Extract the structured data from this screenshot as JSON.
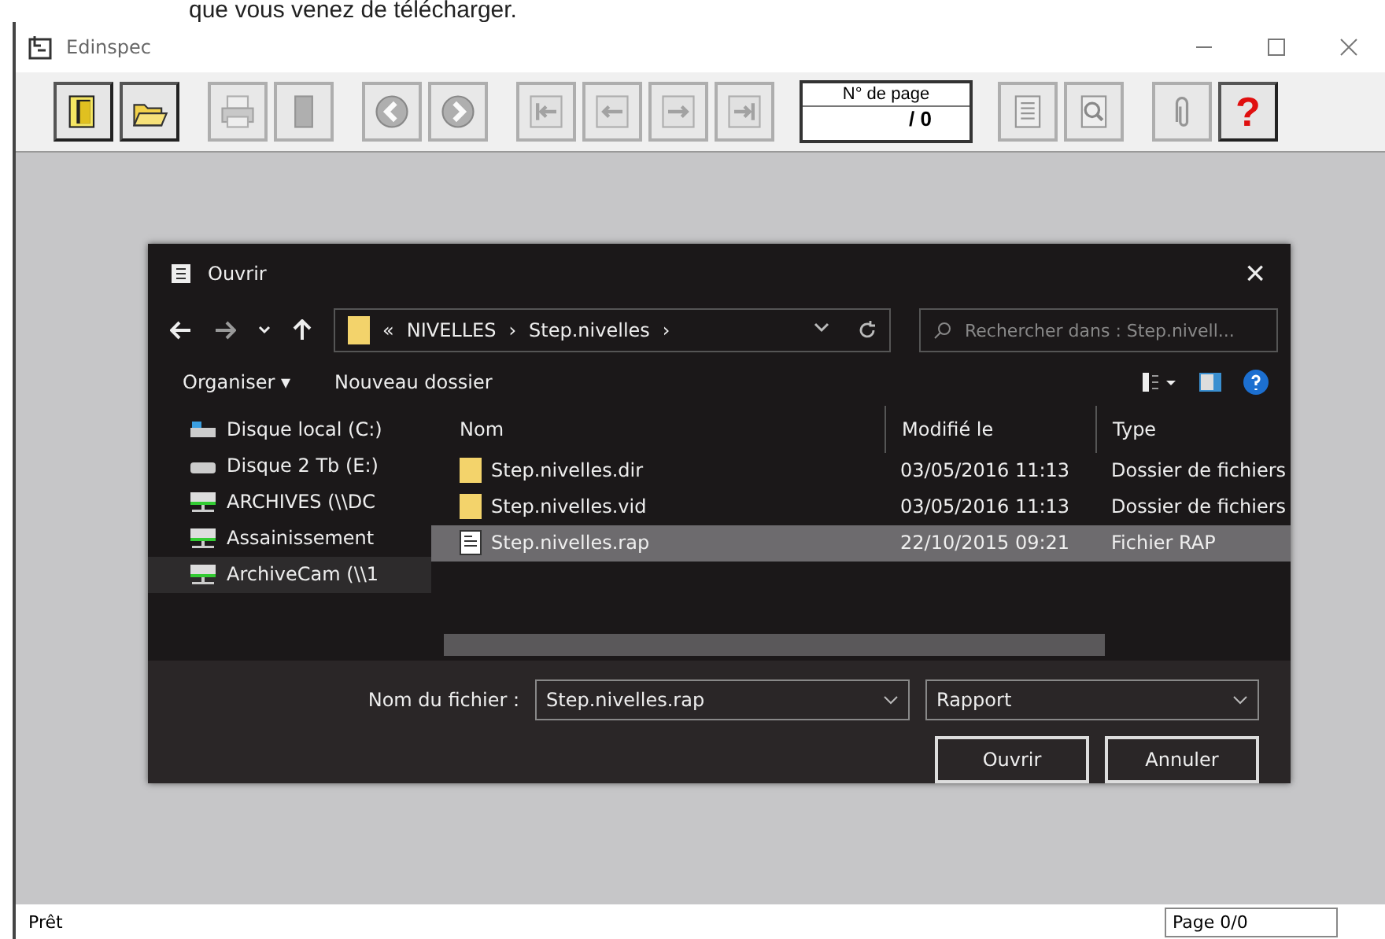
{
  "caption": "que vous venez de télécharger.",
  "window": {
    "title": "Edinspec"
  },
  "toolbar": [
    {
      "kind": "exit",
      "disabled": false
    },
    {
      "kind": "open",
      "disabled": false
    },
    {
      "kind": "print",
      "disabled": true
    },
    {
      "kind": "stop",
      "disabled": true
    },
    {
      "kind": "back",
      "disabled": true
    },
    {
      "kind": "forward",
      "disabled": true
    },
    {
      "kind": "first",
      "disabled": true
    },
    {
      "kind": "previous",
      "disabled": true
    },
    {
      "kind": "next",
      "disabled": true
    },
    {
      "kind": "last",
      "disabled": true
    },
    {
      "kind": "page",
      "label": "N° de page",
      "value": "/ 0"
    },
    {
      "kind": "report",
      "disabled": true
    },
    {
      "kind": "preview",
      "disabled": true
    },
    {
      "kind": "attach",
      "disabled": true
    },
    {
      "kind": "help",
      "disabled": false,
      "text": "?"
    }
  ],
  "dialog": {
    "title": "Ouvrir",
    "close": "×",
    "path": [
      "«",
      "NIVELLES",
      "›",
      "Step.nivelles",
      "›"
    ],
    "search": {
      "placeholder": "Rechercher dans : Step.nivell..."
    },
    "commands": [
      "Organiser ▾",
      "Nouveau dossier"
    ],
    "sidebar": {
      "items": [
        {
          "kind": "local",
          "label": "Disque local (C:)",
          "selected": false
        },
        {
          "kind": "drive",
          "label": "Disque 2 Tb (E:)",
          "selected": false
        },
        {
          "kind": "network",
          "label": "ARCHIVES (\\\\DC",
          "selected": false
        },
        {
          "kind": "network",
          "label": "Assainissement",
          "selected": false
        },
        {
          "kind": "network",
          "label": "ArchiveCam (\\\\1",
          "selected": true
        }
      ]
    },
    "table": {
      "columns": [
        "Nom",
        "Modifié le",
        "Type"
      ],
      "rows": [
        {
          "kind": "folder",
          "name": "Step.nivelles.dir",
          "modified": "03/05/2016 11:13",
          "type": "Dossier de fichiers",
          "selected": false
        },
        {
          "kind": "folder",
          "name": "Step.nivelles.vid",
          "modified": "03/05/2016 11:13",
          "type": "Dossier de fichiers",
          "selected": false
        },
        {
          "kind": "file",
          "name": "Step.nivelles.rap",
          "modified": "22/10/2015 09:21",
          "type": "Fichier RAP",
          "selected": true
        }
      ]
    },
    "filename": {
      "label": "Nom du fichier :",
      "value": "Step.nivelles.rap"
    },
    "filetype": {
      "value": "Rapport"
    },
    "buttons": [
      "Ouvrir",
      "Annuler"
    ]
  },
  "status_bar": {
    "message": "Prêt",
    "page": "Page 0/0"
  }
}
